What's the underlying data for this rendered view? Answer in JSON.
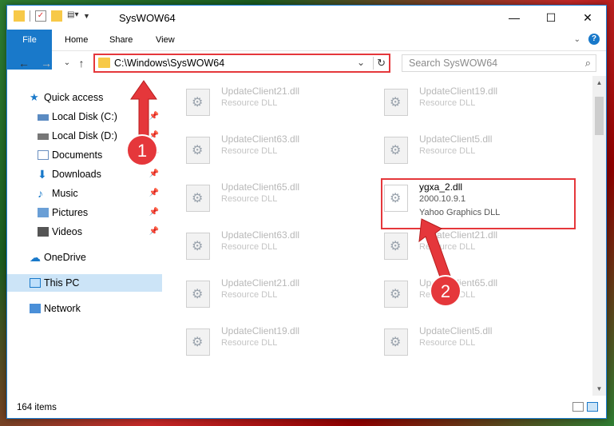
{
  "window": {
    "title": "SysWOW64"
  },
  "ribbon": {
    "tabs": [
      "File",
      "Home",
      "Share",
      "View"
    ]
  },
  "address": {
    "path": "C:\\Windows\\SysWOW64"
  },
  "search": {
    "placeholder": "Search SysWOW64"
  },
  "nav": {
    "items": [
      {
        "label": "Quick access",
        "icon": "star-icon"
      },
      {
        "label": "Local Disk (C:)",
        "icon": "drive-icon",
        "pinned": true
      },
      {
        "label": "Local Disk (D:)",
        "icon": "drive-icon",
        "pinned": true
      },
      {
        "label": "Documents",
        "icon": "documents-icon",
        "pinned": true
      },
      {
        "label": "Downloads",
        "icon": "download-icon",
        "pinned": true
      },
      {
        "label": "Music",
        "icon": "music-icon",
        "pinned": true
      },
      {
        "label": "Pictures",
        "icon": "pictures-icon",
        "pinned": true
      },
      {
        "label": "Videos",
        "icon": "videos-icon",
        "pinned": true
      },
      {
        "label": "OneDrive",
        "icon": "cloud-icon"
      },
      {
        "label": "This PC",
        "icon": "computer-icon"
      },
      {
        "label": "Network",
        "icon": "network-icon"
      }
    ]
  },
  "files": {
    "left": [
      {
        "name": "UpdateClient21.dll",
        "type": "Resource DLL"
      },
      {
        "name": "UpdateClient63.dll",
        "type": "Resource DLL"
      },
      {
        "name": "UpdateClient65.dll",
        "type": "Resource DLL"
      },
      {
        "name": "UpdateClient63.dll",
        "type": "Resource DLL"
      },
      {
        "name": "UpdateClient21.dll",
        "type": "Resource DLL"
      },
      {
        "name": "UpdateClient19.dll",
        "type": "Resource DLL"
      }
    ],
    "right": [
      {
        "name": "UpdateClient19.dll",
        "type": "Resource DLL"
      },
      {
        "name": "UpdateClient5.dll",
        "type": "Resource DLL"
      },
      {
        "name": "ygxa_2.dll",
        "version": "2000.10.9.1",
        "type": "Yahoo Graphics DLL"
      },
      {
        "name": "UpdateClient21.dll",
        "type": "Resource DLL"
      },
      {
        "name": "UpdateClient65.dll",
        "type": "Resource DLL"
      },
      {
        "name": "UpdateClient5.dll",
        "type": "Resource DLL"
      }
    ]
  },
  "status": {
    "count": "164 items"
  },
  "annotations": {
    "step1": "1",
    "step2": "2",
    "color": "#e5373b"
  }
}
